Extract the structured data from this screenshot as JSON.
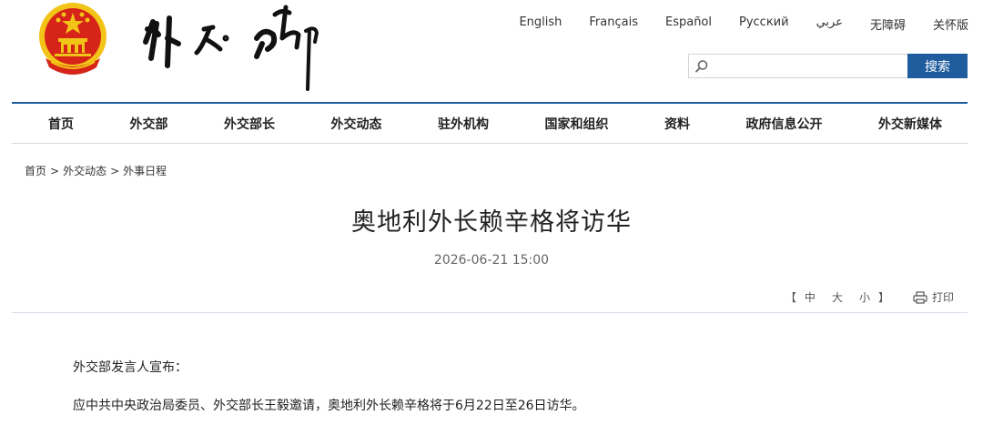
{
  "colors": {
    "accent": "#1f5c9d",
    "emblem_red": "#d62418",
    "emblem_gold": "#f3c418"
  },
  "header": {
    "languages": [
      "English",
      "Français",
      "Español",
      "Русский",
      "عربي",
      "无障碍",
      "关怀版"
    ],
    "search": {
      "placeholder": "",
      "button_label": "搜索"
    }
  },
  "nav": {
    "items": [
      "首页",
      "外交部",
      "外交部长",
      "外交动态",
      "驻外机构",
      "国家和组织",
      "资料",
      "政府信息公开",
      "外交新媒体"
    ]
  },
  "breadcrumb": {
    "items": [
      "首页",
      "外交动态",
      "外事日程"
    ],
    "separator": ">"
  },
  "article": {
    "title": "奥地利外长赖辛格将访华",
    "datetime": "2026-06-21 15:00",
    "paragraphs": [
      "外交部发言人宣布：",
      "应中共中央政治局委员、外交部长王毅邀请，奥地利外长赖辛格将于6月22日至26日访华。"
    ]
  },
  "tools": {
    "bracket_open": "【",
    "sizes": [
      "中",
      "大",
      "小"
    ],
    "bracket_close": "】",
    "print_label": "打印"
  }
}
